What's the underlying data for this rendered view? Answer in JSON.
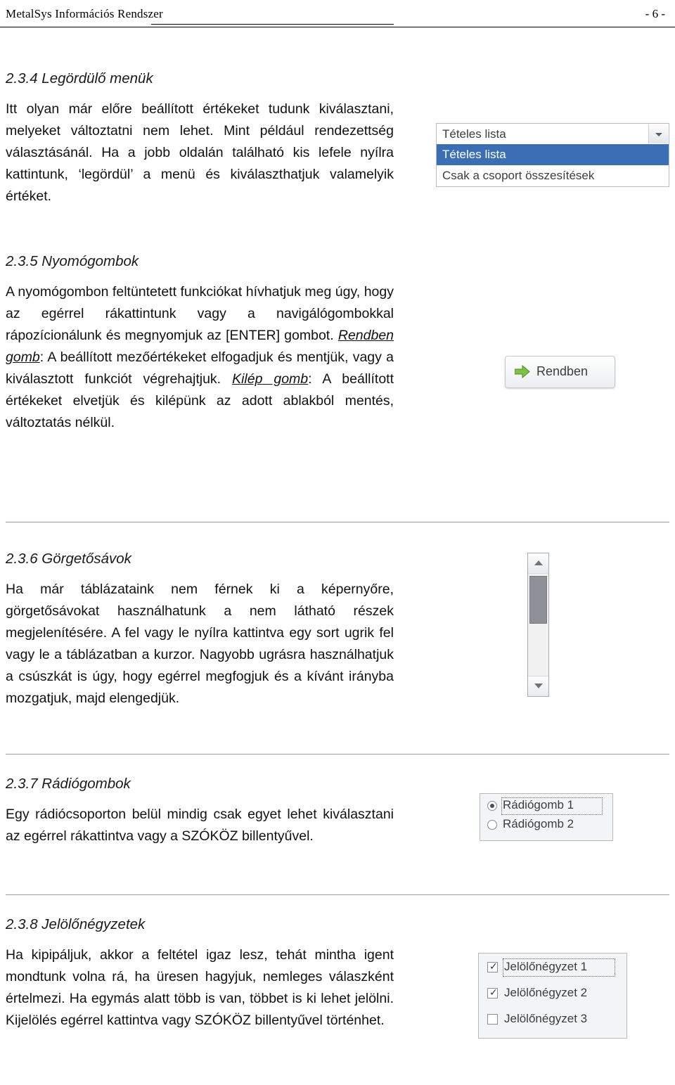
{
  "header": {
    "title": "MetalSys Információs Rendszer",
    "page_number": "- 6 -"
  },
  "sections": [
    {
      "id": "2.3.4",
      "heading": "2.3.4 Legördülő menük",
      "body": "Itt olyan már előre beállított értékeket tudunk kiválasztani, melyeket változtatni nem lehet. Mint például rendezettség választásánál. Ha a jobb oldalán található kis lefele nyílra kattintunk, ‘legördül’ a menü és kiválaszthatjuk valamelyik értéket."
    },
    {
      "id": "2.3.5",
      "heading": "2.3.5 Nyomógombok",
      "body_part1": "A nyomógombon feltüntetett funkciókat hívhatjuk meg úgy, hogy az egérrel rákattintunk vagy a navigálógombokkal rápozícionálunk és megnyomjuk az [ENTER] gombot.",
      "term1": "Rendben gomb",
      "body_part2": ": A beállított mezőértékeket elfogadjuk és mentjük, vagy a kiválasztott funkciót végrehajtjuk.",
      "term2": "Kilép gomb",
      "body_part3": ": A beállított értékeket elvetjük és kilépünk az adott ablakból mentés, változtatás nélkül."
    },
    {
      "id": "2.3.6",
      "heading": "2.3.6 Görgetősávok",
      "body": "Ha már táblázataink nem férnek ki a képernyőre, görgetősávokat használhatunk a nem látható részek megjelenítésére. A fel vagy le nyílra kattintva egy sort ugrik fel vagy le a táblázatban a kurzor. Nagyobb ugrásra használhatjuk a csúszkát is úgy, hogy egérrel megfogjuk és a kívánt irányba mozgatjuk, majd elengedjük."
    },
    {
      "id": "2.3.7",
      "heading": "2.3.7 Rádiógombok",
      "body": "Egy rádiócsoporton belül mindig csak egyet lehet kiválasztani az egérrel rákattintva vagy a SZÓKÖZ billentyűvel."
    },
    {
      "id": "2.3.8",
      "heading": "2.3.8 Jelölőnégyzetek",
      "body": "Ha kipipáljuk, akkor a feltétel igaz lesz, tehát mintha igent mondtunk volna rá, ha üresen hagyjuk, nemleges válaszként értelmezi. Ha egymás alatt több is van, többet is ki lehet jelölni. Kijelölés egérrel kattintva vagy SZÓKÖZ billentyűvel történhet."
    }
  ],
  "widgets": {
    "dropdown": {
      "selected_value": "Tételes lista",
      "options": [
        "Tételes lista",
        "Csak a csoport összesítések"
      ],
      "highlight_color": "#3a6fb5"
    },
    "button": {
      "label": "Rendben",
      "arrow_color": "#6db33f"
    },
    "scrollbar": {
      "up_icon": "chevron-up-icon",
      "down_icon": "chevron-down-icon",
      "thumb_color": "#8e9097"
    },
    "radio_group": {
      "options": [
        {
          "label": "Rádiógomb 1",
          "selected": true
        },
        {
          "label": "Rádiógomb 2",
          "selected": false
        }
      ]
    },
    "checkbox_group": {
      "options": [
        {
          "label": "Jelölőnégyzet 1",
          "checked": true
        },
        {
          "label": "Jelölőnégyzet 2",
          "checked": true
        },
        {
          "label": "Jelölőnégyzet 3",
          "checked": false
        }
      ]
    }
  }
}
